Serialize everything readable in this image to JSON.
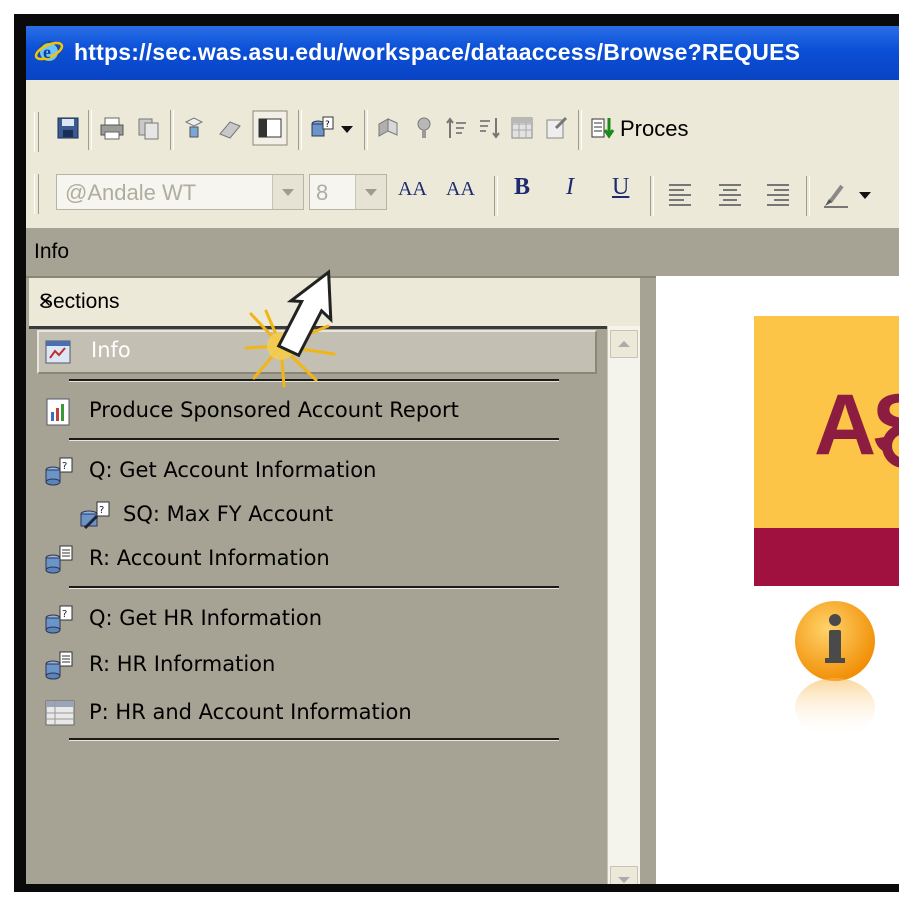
{
  "browser": {
    "url": "https://sec.was.asu.edu/workspace/dataaccess/Browse?REQUES"
  },
  "toolbar": {
    "process_label": "Proces",
    "font_name": "@Andale WT",
    "font_size": "8",
    "bold_label": "B",
    "italic_label": "I",
    "underline_label": "U",
    "grow_font_label": "AA",
    "shrink_font_label": "AA"
  },
  "info_bar": {
    "title": "Info"
  },
  "sections_panel": {
    "title": "Sections",
    "close_glyph": "×",
    "items": [
      {
        "label": "Info",
        "icon": "info-section-icon",
        "selected": true
      },
      {
        "label": "Produce Sponsored Account Report",
        "icon": "report-icon"
      },
      {
        "label": "Q: Get Account Information",
        "icon": "query-icon"
      },
      {
        "label": "SQ: Max FY Account",
        "icon": "subquery-icon"
      },
      {
        "label": "R: Account Information",
        "icon": "results-icon"
      },
      {
        "label": "Q: Get HR Information",
        "icon": "query-icon"
      },
      {
        "label": "R: HR Information",
        "icon": "results-icon"
      },
      {
        "label": "P: HR and Account Information",
        "icon": "pivot-icon"
      }
    ]
  },
  "content": {
    "logo_text": "AS",
    "colors": {
      "gold": "#fcc548",
      "maroon": "#8c1d40",
      "band": "#a0113f"
    }
  },
  "colors": {
    "titlebar": "#0a4fd6",
    "toolbar": "#ece9d8",
    "panel": "#a6a294"
  }
}
